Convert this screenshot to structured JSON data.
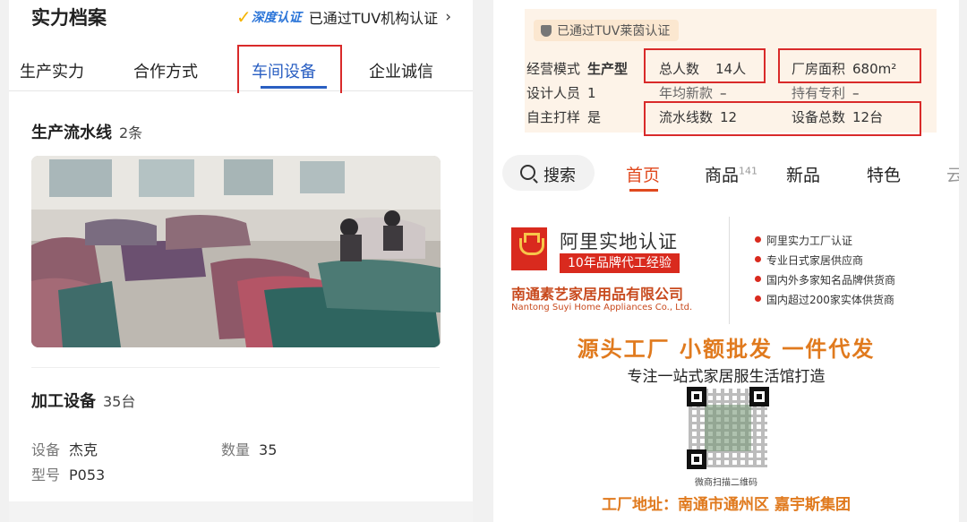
{
  "left_panel": {
    "title": "实力档案",
    "certification": {
      "brand": "深度认证",
      "text": "已通过TUV机构认证"
    },
    "tabs": [
      {
        "label": "生产实力",
        "active": false
      },
      {
        "label": "合作方式",
        "active": false
      },
      {
        "label": "车间设备",
        "active": true
      },
      {
        "label": "企业诚信",
        "active": false
      }
    ],
    "production_line": {
      "label": "生产流水线",
      "count": "2条"
    },
    "processing_equipment": {
      "label": "加工设备",
      "count": "35台"
    },
    "details": {
      "device": {
        "label": "设备",
        "value": "杰克"
      },
      "quantity": {
        "label": "数量",
        "value": "35"
      },
      "model": {
        "label": "型号",
        "value": "P053"
      }
    }
  },
  "right_panel": {
    "tuv_badge": "已通过TUV莱茵认证",
    "stats": {
      "business_mode": {
        "label": "经营模式",
        "value": "生产型"
      },
      "total_people": {
        "label": "总人数",
        "value": "14人"
      },
      "factory_area": {
        "label": "厂房面积",
        "value": "680m²"
      },
      "designers": {
        "label": "设计人员",
        "value": "1"
      },
      "annual_new": {
        "label": "年均新款",
        "value": "–"
      },
      "patents": {
        "label": "持有专利",
        "value": "–"
      },
      "self_sampling": {
        "label": "自主打样",
        "value": "是"
      },
      "production_lines": {
        "label": "流水线数",
        "value": "12"
      },
      "total_equipment": {
        "label": "设备总数",
        "value": "12台"
      }
    },
    "search": {
      "label": "搜索"
    },
    "tabs": [
      {
        "label": "首页",
        "active": true
      },
      {
        "label": "商品",
        "count": "141"
      },
      {
        "label": "新品"
      },
      {
        "label": "特色"
      },
      {
        "label": "云"
      }
    ],
    "banner": {
      "ali_cert": "阿里实地认证",
      "experience": "10年品牌代工经验",
      "company_cn": "南通素艺家居用品有限公司",
      "company_en": "Nantong Suyi Home Appliances Co., Ltd.",
      "features": [
        "阿里实力工厂认证",
        "专业日式家居供应商",
        "国内外多家知名品牌供货商",
        "国内超过200家实体供货商"
      ],
      "slogan": "源头工厂 小额批发 一件代发",
      "subslogan": "专注一站式家居服生活馆打造",
      "qr_caption": "微商扫描二维码",
      "address": "工厂地址：南通市通州区 嘉宇斯集团"
    }
  },
  "colors": {
    "highlight_box": "#d92a2a",
    "left_active_tab": "#2a5fc2",
    "right_active_tab": "#e0491e",
    "slogan_orange": "#e07a1e",
    "stats_bg": "#fdf3e8"
  }
}
